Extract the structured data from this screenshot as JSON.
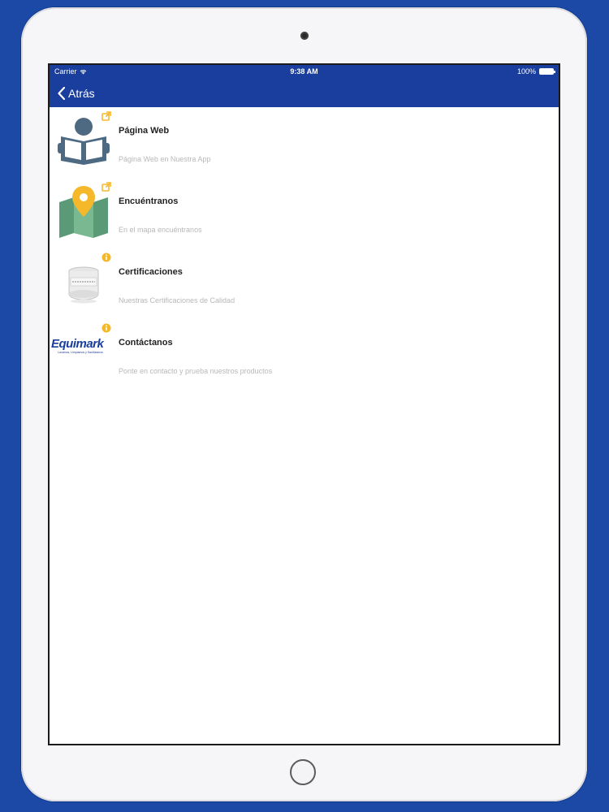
{
  "statusbar": {
    "carrier": "Carrier",
    "time": "9:38 AM",
    "battery": "100%"
  },
  "navbar": {
    "back_label": "Atrás"
  },
  "items": [
    {
      "title": "Página Web",
      "subtitle": "Página Web en Nuestra App",
      "icon": "reader-book-icon",
      "badge": "external-link-icon"
    },
    {
      "title": "Encuéntranos",
      "subtitle": "En el mapa encuéntranos",
      "icon": "map-pin-icon",
      "badge": "external-link-icon"
    },
    {
      "title": "Certificaciones",
      "subtitle": "Nuestras Certificaciones de Calidad",
      "icon": "certificate-product-icon",
      "badge": "info-icon"
    },
    {
      "title": "Contáctanos",
      "subtitle": "Ponte en contacto y prueba nuestros productos",
      "icon": "equimark-logo",
      "badge": "info-icon",
      "logo_text": "Equimark",
      "logo_tagline": "Lavamos, Limpiamos y Sanitizamos"
    }
  ],
  "colors": {
    "brand": "#1a3e9e",
    "badge": "#f5b82a",
    "title": "#222222",
    "subtitle": "#b8b8b8"
  }
}
